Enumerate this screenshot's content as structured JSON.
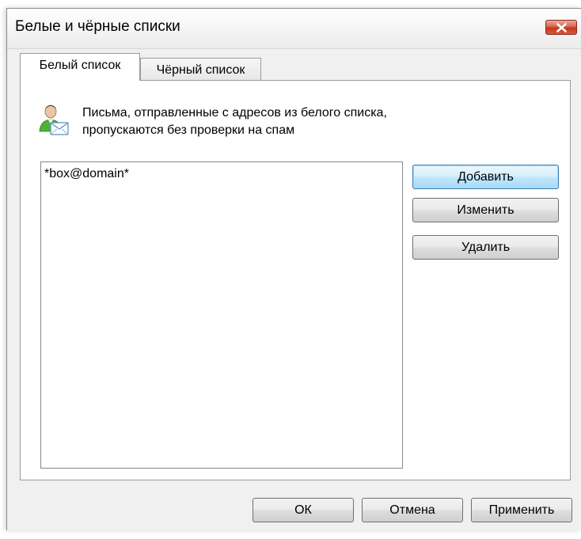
{
  "window": {
    "title": "Белые и чёрные списки"
  },
  "tabs": [
    {
      "label": "Белый список",
      "active": true
    },
    {
      "label": "Чёрный список",
      "active": false
    }
  ],
  "info": {
    "icon": "user-mail-icon",
    "line1": "Письма, отправленные с адресов из белого списка,",
    "line2": "пропускаются без проверки на спам"
  },
  "list": {
    "items": [
      "*box@domain*"
    ]
  },
  "side_buttons": {
    "add": "Добавить",
    "edit": "Изменить",
    "delete": "Удалить"
  },
  "footer_buttons": {
    "ok": "ОК",
    "cancel": "Отмена",
    "apply": "Применить"
  },
  "colors": {
    "close_button": "#c3391a",
    "default_button_border": "#3c7fb1"
  }
}
